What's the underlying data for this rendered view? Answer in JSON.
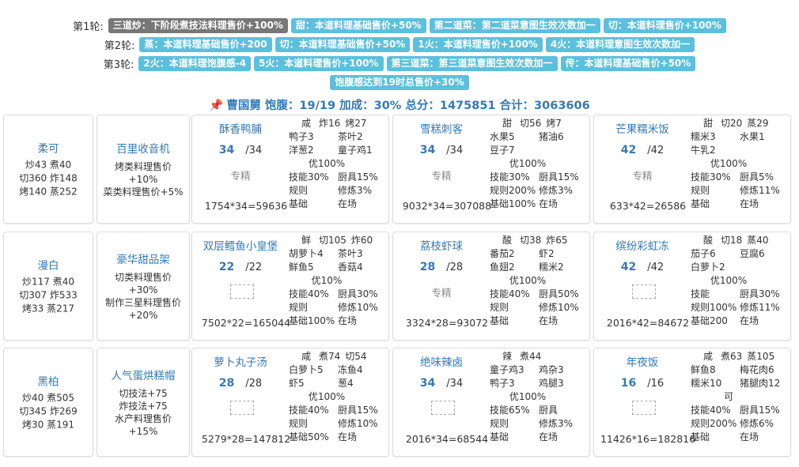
{
  "rounds": [
    {
      "label": "第1轮:",
      "tags": [
        {
          "text": "三道炒：下阶段煮技法料理售价+100%",
          "style": "gray"
        },
        {
          "text": "甜：本道料理基础售价+50%",
          "style": "blue"
        },
        {
          "text": "第二道菜：第二道菜意图生效次数加一",
          "style": "blue"
        },
        {
          "text": "切：本道料理售价+100%",
          "style": "blue"
        }
      ]
    },
    {
      "label": "第2轮:",
      "tags": [
        {
          "text": "蒸：本道料理基础售价+200",
          "style": "blue"
        },
        {
          "text": "切：本道料理基础售价+50%",
          "style": "blue"
        },
        {
          "text": "1火：本道料理售价+100%",
          "style": "blue"
        },
        {
          "text": "4火：本道料理意图生效次数加一",
          "style": "blue"
        }
      ]
    },
    {
      "label": "第3轮:",
      "tags": [
        {
          "text": "2火：本道料理饱腹感-4",
          "style": "blue"
        },
        {
          "text": "5火：本道料理售价+100%",
          "style": "blue"
        },
        {
          "text": "第三道菜：第三道菜意图生效次数加一",
          "style": "blue"
        },
        {
          "text": "传：本道料理基础售价+50%",
          "style": "blue"
        }
      ]
    },
    {
      "label": "",
      "tags": [
        {
          "text": "饱腹感达到19时总售价+30%",
          "style": "blue"
        }
      ]
    }
  ],
  "summary": "曹国舅 饱腹：19/19 加成：30% 总分：1475851 合计：3063606",
  "rows": [
    {
      "chef": {
        "name": "柔可",
        "stats": [
          "炒43 煮40",
          "切360 炸148",
          "烤140 蒸252"
        ]
      },
      "equip": {
        "name": "百里收音机",
        "effects": [
          "烤类料理售价+10%",
          "菜类料理售价+5%"
        ]
      },
      "dishes": [
        {
          "name": "酥香鸭脯",
          "qty": "34",
          "max": "/34",
          "skill": "专精",
          "img": false,
          "formula": "1754*34=59636",
          "attr": [
            "咸",
            "炸16",
            "烤27"
          ],
          "ing": [
            [
              "鸭子3",
              "茶叶2"
            ],
            [
              "洋葱2",
              "童子鸡1"
            ]
          ],
          "rate": "优100%",
          "stats": [
            [
              "技能30%",
              "厨具15%"
            ],
            [
              "规则",
              "修炼3%"
            ],
            [
              "基础",
              "在场"
            ]
          ]
        },
        {
          "name": "雪糕刺客",
          "qty": "34",
          "max": "/34",
          "skill": "专精",
          "img": false,
          "formula": "9032*34=307088",
          "attr": [
            "甜",
            "切56",
            "烤7"
          ],
          "ing": [
            [
              "水果5",
              "猪油6"
            ],
            [
              "豆子7",
              ""
            ]
          ],
          "rate": "优100%",
          "stats": [
            [
              "技能30%",
              "厨具15%"
            ],
            [
              "规则200%",
              "修炼3%"
            ],
            [
              "基础100%",
              "在场"
            ]
          ]
        },
        {
          "name": "芒果糯米饭",
          "qty": "42",
          "max": "/42",
          "skill": "专精",
          "img": false,
          "formula": "633*42=26586",
          "attr": [
            "甜",
            "切20",
            "蒸29"
          ],
          "ing": [
            [
              "糯米3",
              "水果1"
            ],
            [
              "牛乳2",
              ""
            ]
          ],
          "rate": "优100%",
          "stats": [
            [
              "技能30%",
              "厨具5%"
            ],
            [
              "规则",
              "修炼11%"
            ],
            [
              "基础",
              "在场"
            ]
          ]
        }
      ]
    },
    {
      "chef": {
        "name": "漫白",
        "stats": [
          "炒117 煮40",
          "切307 炸533",
          "烤33 蒸217"
        ]
      },
      "equip": {
        "name": "豪华甜品架",
        "effects": [
          "切类料理售价+30%",
          "制作三星料理售价",
          "+20%"
        ]
      },
      "dishes": [
        {
          "name": "双层鳕鱼小皇堡",
          "qty": "22",
          "max": "/22",
          "skill": "",
          "img": true,
          "formula": "7502*22=165044",
          "attr": [
            "鲜",
            "切105",
            "炸60"
          ],
          "ing": [
            [
              "胡萝卜4",
              "茶叶3"
            ],
            [
              "鲜鱼5",
              "香菇4"
            ]
          ],
          "rate": "优10%",
          "stats": [
            [
              "技能40%",
              "厨具30%"
            ],
            [
              "规则",
              "修炼10%"
            ],
            [
              "基础100%",
              "在场"
            ]
          ]
        },
        {
          "name": "荔枝虾球",
          "qty": "28",
          "max": "/28",
          "skill": "专精",
          "img": false,
          "formula": "3324*28=93072",
          "attr": [
            "酸",
            "切38",
            "炸65"
          ],
          "ing": [
            [
              "番茄2",
              "虾2"
            ],
            [
              "鱼翅2",
              "糯米2"
            ]
          ],
          "rate": "优100%",
          "stats": [
            [
              "技能40%",
              "厨具50%"
            ],
            [
              "规则",
              "修炼10%"
            ],
            [
              "基础",
              "在场"
            ]
          ]
        },
        {
          "name": "缤纷彩虹冻",
          "qty": "42",
          "max": "/42",
          "skill": "",
          "img": true,
          "formula": "2016*42=84672",
          "attr": [
            "酸",
            "切18",
            "蒸40"
          ],
          "ing": [
            [
              "茄子6",
              "豆腐6"
            ],
            [
              "白萝卜2",
              ""
            ]
          ],
          "rate": "优100%",
          "stats": [
            [
              "技能",
              "厨具30%"
            ],
            [
              "规则100%",
              "修炼11%"
            ],
            [
              "基础200",
              "在场"
            ]
          ]
        }
      ]
    },
    {
      "chef": {
        "name": "黑柏",
        "stats": [
          "炒40 煮505",
          "切345 炸269",
          "烤30 蒸191"
        ]
      },
      "equip": {
        "name": "人气蛋烘糕帽",
        "effects": [
          "切技法+75",
          "炸技法+75",
          "水产料理售价+15%"
        ]
      },
      "dishes": [
        {
          "name": "萝卜丸子汤",
          "qty": "28",
          "max": "/28",
          "skill": "",
          "img": true,
          "formula": "5279*28=147812",
          "attr": [
            "咸",
            "煮74",
            "切54"
          ],
          "ing": [
            [
              "白萝卜5",
              "冻鱼4"
            ],
            [
              "虾5",
              "葱4"
            ]
          ],
          "rate": "优100%",
          "stats": [
            [
              "技能40%",
              "厨具15%"
            ],
            [
              "规则",
              "修炼10%"
            ],
            [
              "基础50%",
              "在场"
            ]
          ]
        },
        {
          "name": "绝味辣卤",
          "qty": "34",
          "max": "/34",
          "skill": "",
          "img": true,
          "formula": "2016*34=68544",
          "attr": [
            "辣",
            "煮44",
            ""
          ],
          "ing": [
            [
              "童子鸡3",
              "鸡杂3"
            ],
            [
              "鸭子3",
              "鸡腿3"
            ]
          ],
          "rate": "优100%",
          "stats": [
            [
              "技能65%",
              "厨具"
            ],
            [
              "规则",
              "修炼3%"
            ],
            [
              "基础",
              "在场"
            ]
          ]
        },
        {
          "name": "年夜饭",
          "qty": "16",
          "max": "/16",
          "skill": "",
          "img": true,
          "formula": "11426*16=182816",
          "attr": [
            "咸",
            "煮63",
            "蒸105"
          ],
          "ing": [
            [
              "鲜鱼8",
              "梅花肉6"
            ],
            [
              "糯米10",
              "猪腿肉12"
            ]
          ],
          "rate": "可",
          "stats": [
            [
              "技能40%",
              "厨具15%"
            ],
            [
              "规则200%",
              "修炼6%"
            ],
            [
              "基础",
              "在场"
            ]
          ]
        }
      ]
    }
  ]
}
